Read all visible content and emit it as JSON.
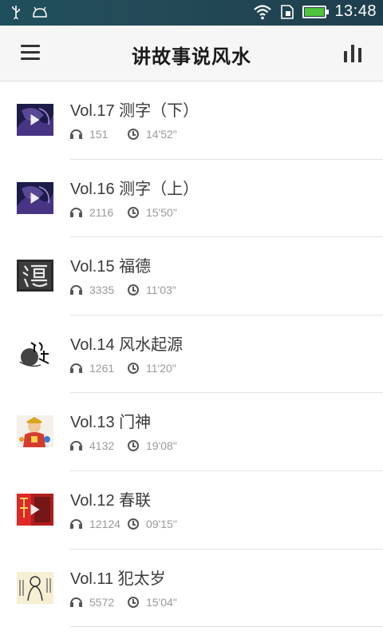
{
  "status_bar": {
    "time": "13:48",
    "icons": [
      "usb-icon",
      "android-icon",
      "wifi-icon",
      "sim-icon",
      "battery-icon"
    ],
    "battery_color": "#4ec43a"
  },
  "header": {
    "title": "讲故事说风水",
    "left_icon": "menu-icon",
    "right_icon": "bar-chart-icon"
  },
  "episodes": [
    {
      "title": "Vol.17 测字（下）",
      "plays": "151",
      "duration": "14'52\"",
      "thumb": "purple-swirl",
      "has_play_badge": true
    },
    {
      "title": "Vol.16 测字（上）",
      "plays": "2116",
      "duration": "15'50\"",
      "thumb": "purple-swirl",
      "has_play_badge": true
    },
    {
      "title": "Vol.15 福德",
      "plays": "3335",
      "duration": "11'03\"",
      "thumb": "calligraphy-de",
      "has_play_badge": false
    },
    {
      "title": "Vol.14 风水起源",
      "plays": "1261",
      "duration": "11'20\"",
      "thumb": "ink-calligraphy",
      "has_play_badge": false
    },
    {
      "title": "Vol.13 门神",
      "plays": "4132",
      "duration": "19'08\"",
      "thumb": "door-god",
      "has_play_badge": false
    },
    {
      "title": "Vol.12 春联",
      "plays": "12124",
      "duration": "09'15\"",
      "thumb": "red-couplet",
      "has_play_badge": true
    },
    {
      "title": "Vol.11 犯太岁",
      "plays": "5572",
      "duration": "15'04\"",
      "thumb": "taisui-scroll",
      "has_play_badge": false
    }
  ]
}
